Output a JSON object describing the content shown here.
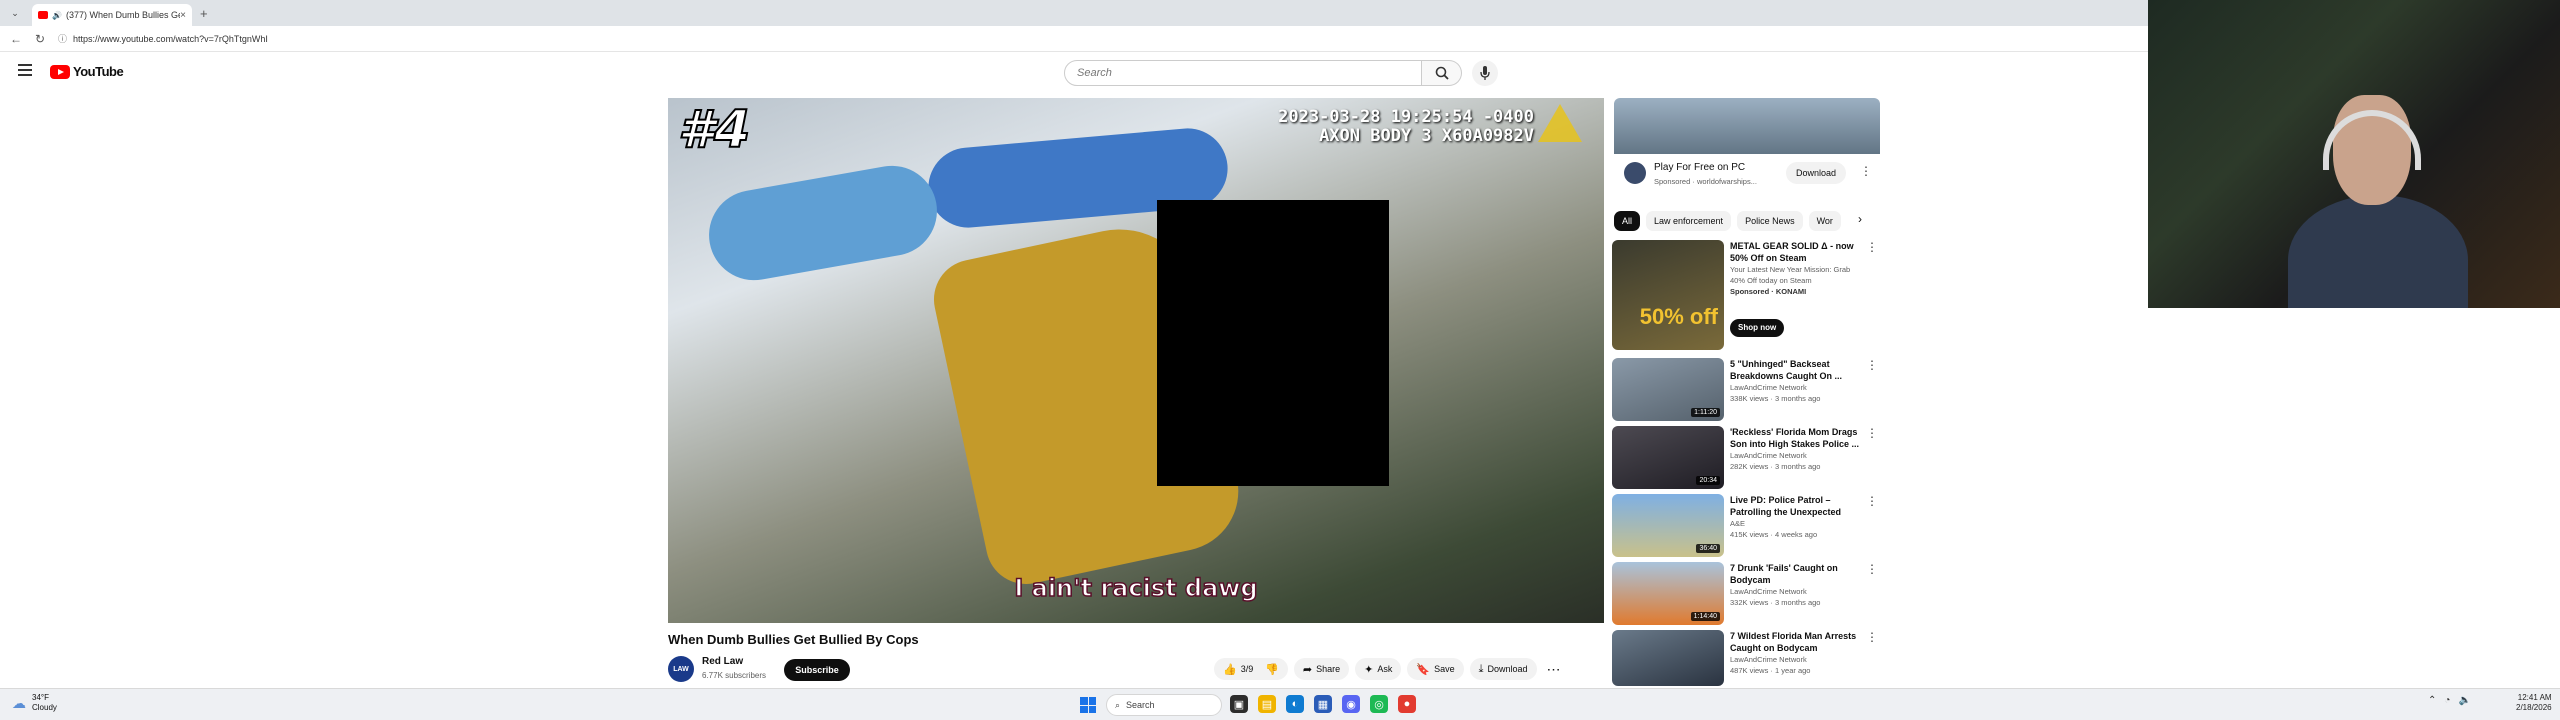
{
  "browser": {
    "tab_title": "(377) When Dumb Bullies Get",
    "tab_close": "×",
    "new_tab": "+",
    "url": "https://www.youtube.com/watch?v=7rQhTtgnWhI"
  },
  "youtube": {
    "logo_text": "YouTube",
    "search_placeholder": "Search"
  },
  "video": {
    "overlay_rank": "#4",
    "cam_timestamp": "2023-03-28 19:25:54 -0400",
    "cam_model": "AXON BODY 3 X60A0982V",
    "subtitle": "I ain't racist dawg",
    "title": "When Dumb Bullies Get Bullied By Cops",
    "channel_name": "Red Law",
    "channel_avatar": "LAW",
    "channel_subs": "6.77K subscribers",
    "subscribe_label": "Subscribe",
    "like_count": "3/9",
    "share_label": "Share",
    "ask_label": "Ask",
    "save_label": "Save",
    "download_label": "Download"
  },
  "sidebar": {
    "ad": {
      "title": "Play For Free on PC",
      "sub": "Sponsored · worldofwarships...",
      "button": "Download"
    },
    "chips": [
      "All",
      "Law enforcement",
      "Police News",
      "Wor"
    ],
    "recs": [
      {
        "title": "METAL GEAR SOLID Δ - now 50% Off on Steam",
        "line1": "Your Latest New Year Mission: Grab",
        "line2": "40% Off today on Steam",
        "line3": "Sponsored · KONAMI",
        "button": "Shop now",
        "thumb_text": "50% off",
        "dur": ""
      },
      {
        "title": "5 \"Unhinged\" Backseat Breakdowns Caught On ...",
        "line1": "LawAndCrime Network",
        "line2": "338K views · 3 months ago",
        "dur": "1:11:20"
      },
      {
        "title": "'Reckless' Florida Mom Drags Son into High Stakes Police ...",
        "line1": "LawAndCrime Network",
        "line2": "282K views · 3 months ago",
        "dur": "20:34"
      },
      {
        "title": "Live PD: Police Patrol – Patrolling the Unexpected (Par...",
        "line1": "A&E",
        "line2": "415K views · 4 weeks ago",
        "dur": "36:40"
      },
      {
        "title": "7 Drunk 'Fails' Caught on Bodycam",
        "line1": "LawAndCrime Network",
        "line2": "332K views · 3 months ago",
        "dur": "1:14:40"
      },
      {
        "title": "7 Wildest Florida Man Arrests Caught on Bodycam",
        "line1": "LawAndCrime Network",
        "line2": "487K views · 1 year ago",
        "dur": ""
      }
    ]
  },
  "taskbar": {
    "temp": "34°F",
    "weather": "Cloudy",
    "search": "Search",
    "time": "12:41 AM",
    "date": "2/18/2026"
  },
  "colors": {
    "youtube_red": "#ff0000",
    "subscribe_bg": "#0f0f0f",
    "chip_active_bg": "#0f0f0f"
  }
}
